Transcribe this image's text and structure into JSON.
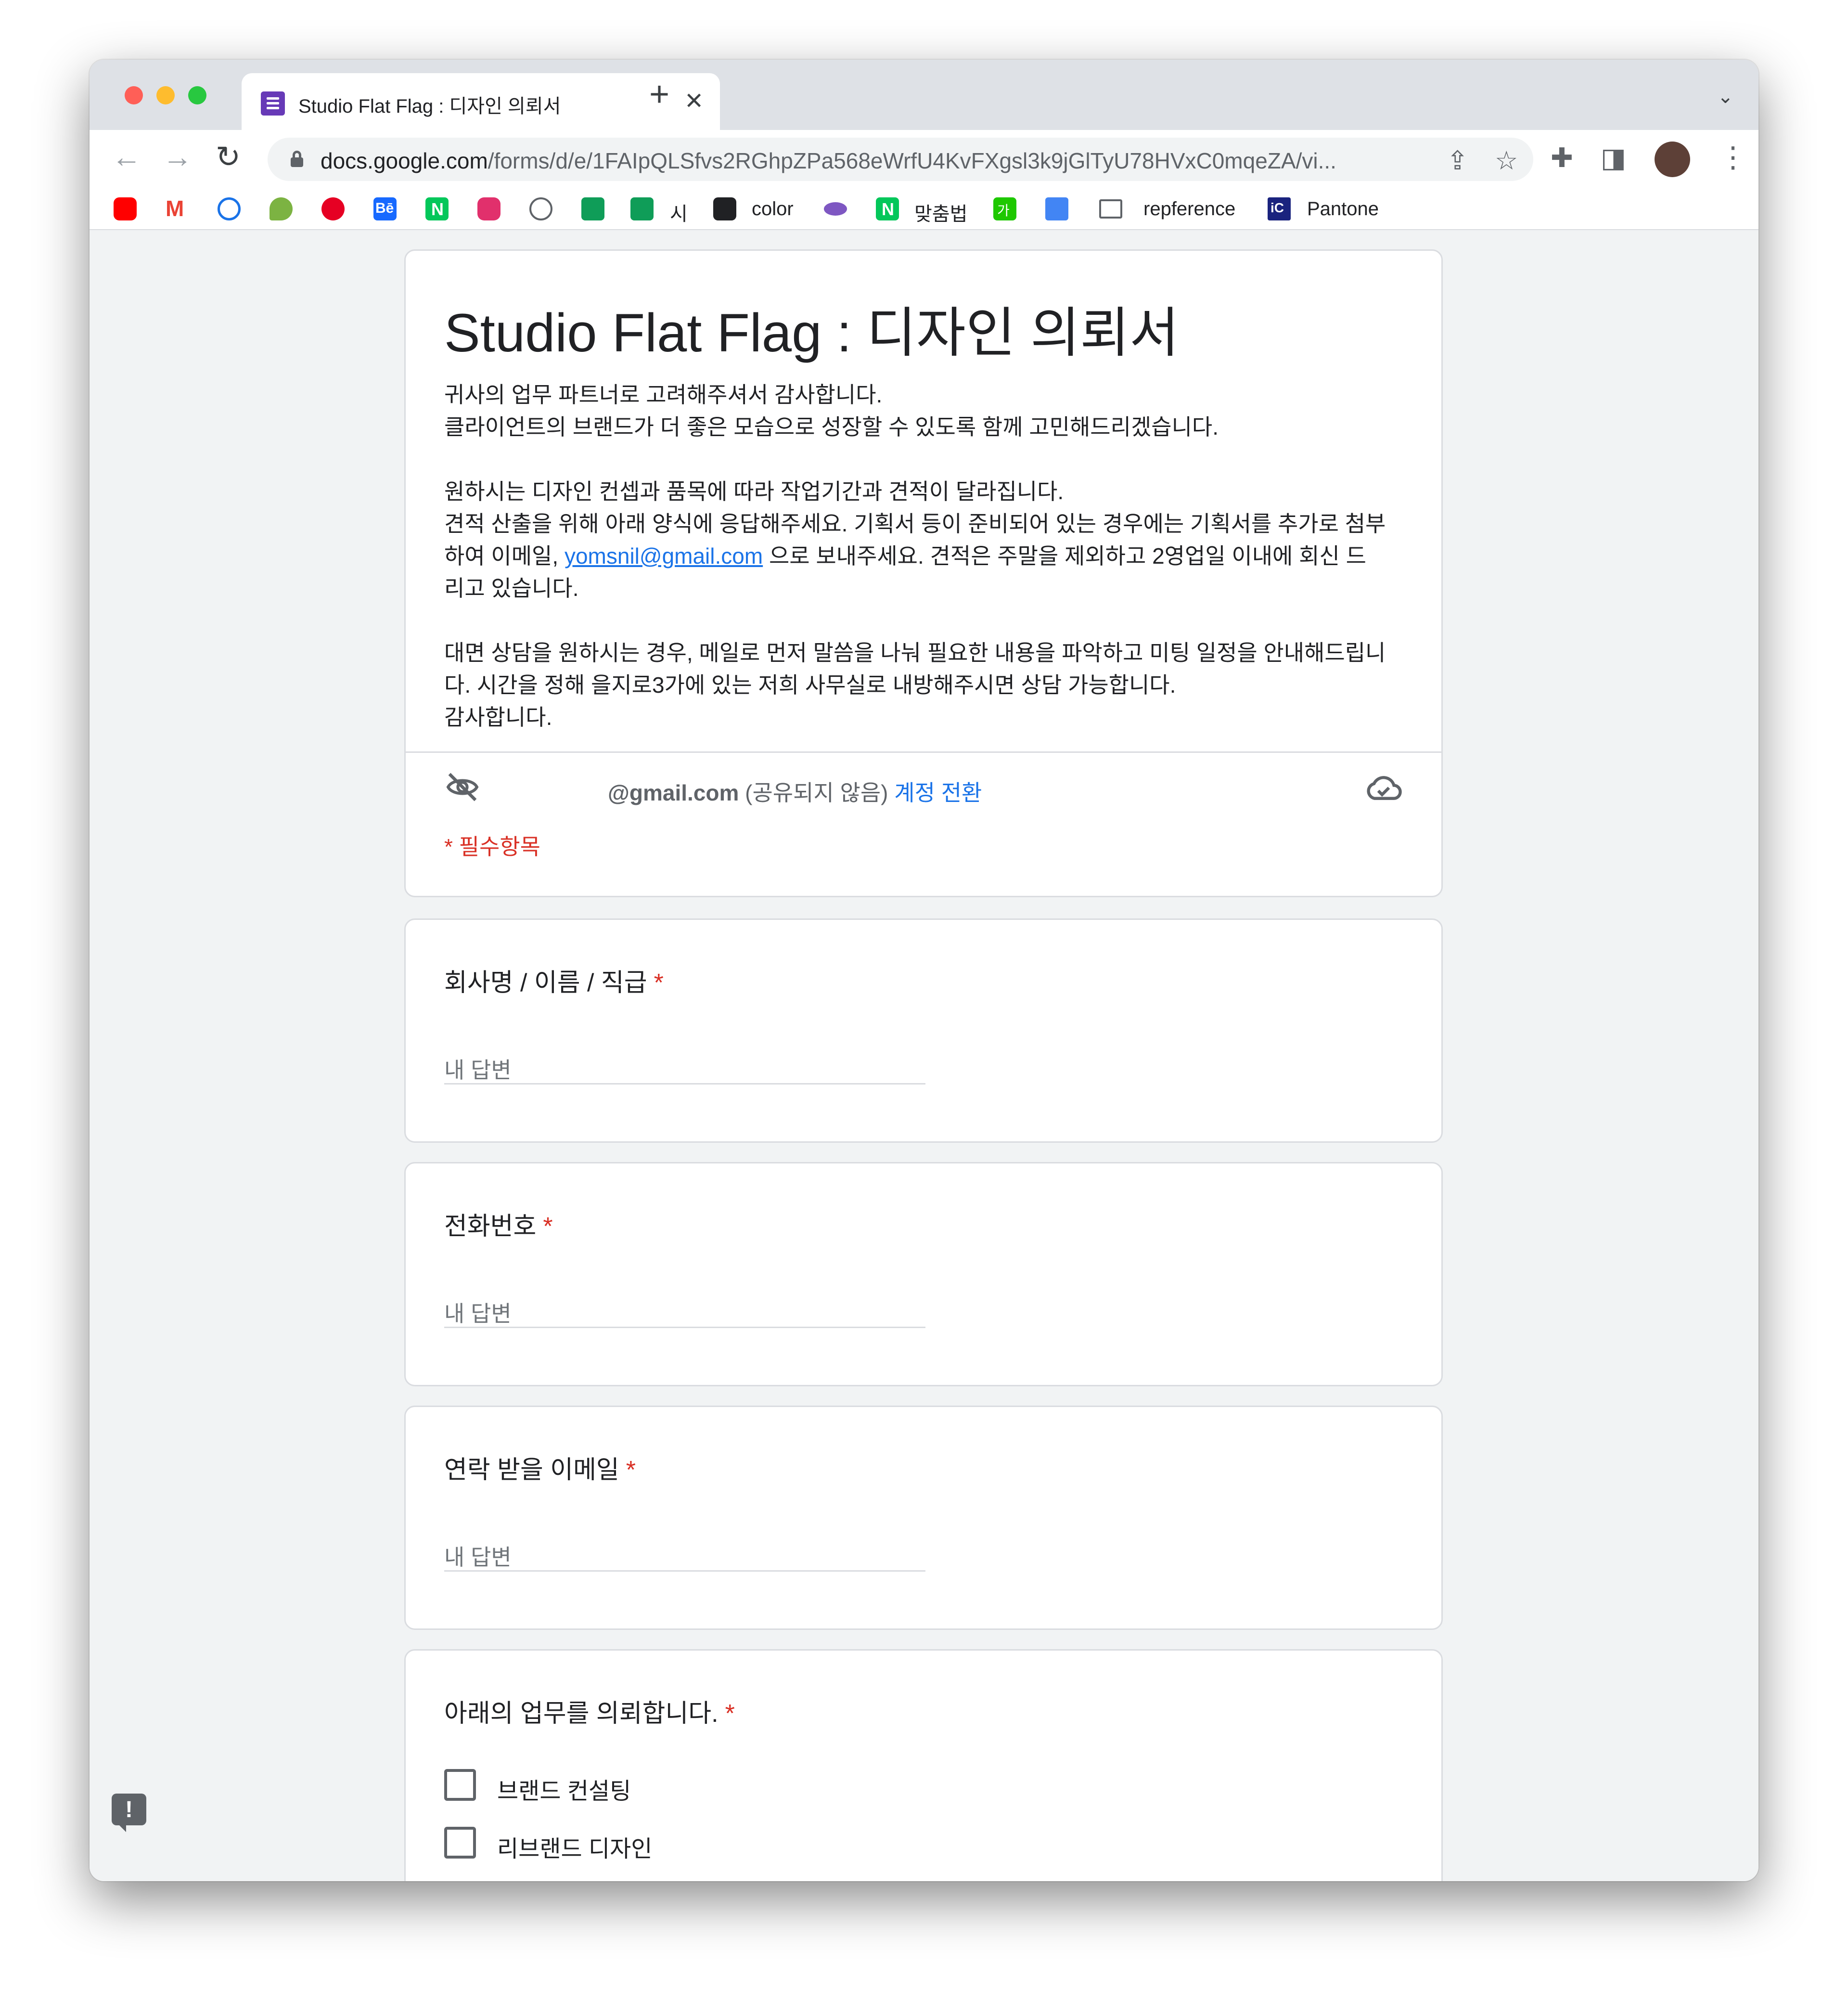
{
  "browser": {
    "tab_title": "Studio Flat Flag : 디자인 의뢰서",
    "tab_close": "✕",
    "new_tab": "+",
    "tab_menu": "⌄",
    "url_domain": "docs.google.com",
    "url_path": "/forms/d/e/1FAIpQLSfvs2RGhpZPa568eWrfU4KvFXgsl3k9jGlTyU78HVxC0mqeZA/vi...",
    "nav": {
      "back": "←",
      "forward": "→",
      "reload": "↻"
    },
    "icons": [
      "lock-icon",
      "share-icon",
      "star-icon",
      "extensions-icon",
      "side-panel-icon",
      "profile-avatar",
      "menu-icon"
    ],
    "share_glyph": "⇪",
    "star_glyph": "☆",
    "ext_glyph": "✚",
    "side_glyph": "◨",
    "kebab_glyph": "⋮"
  },
  "bookmarks": {
    "si": "시",
    "color": "color",
    "matchumbeop": "맞춤법",
    "ga": "가",
    "repference": "repference",
    "pantone": "Pantone",
    "n_glyph": "N",
    "be_glyph": "Bē",
    "ic_glyph": "iC",
    "colors": {
      "youtube": "#ff0000",
      "gmail": "#ea4335",
      "pinterest": "#e60023",
      "behance": "#1769ff",
      "naver": "#03c75a",
      "instagram": "#e1306c",
      "sheets": "#0f9d58"
    }
  },
  "form": {
    "title": "Studio Flat Flag : 디자인 의뢰서",
    "desc": {
      "p1_line1": "귀사의 업무 파트너로 고려해주셔서 감사합니다.",
      "p1_line2": "클라이언트의 브랜드가 더 좋은 모습으로 성장할 수 있도록 함께 고민해드리겠습니다.",
      "p2_line1": "원하시는 디자인 컨셉과 품목에 따라 작업기간과 견적이 달라집니다.",
      "p2_line2": "견적 산출을 위해 아래 양식에 응답해주세요. 기획서 등이 준비되어 있는 경우에는 기획서를 추가로 첨부",
      "p2_line3_pre": "하여 이메일, ",
      "email": "yomsnil@gmail.com",
      "p2_line3_post": " 으로 보내주세요. 견적은 주말을 제외하고 2영업일 이내에 회신 드",
      "p2_line4": "리고 있습니다.",
      "p3_line1": "대면 상담을 원하시는 경우, 메일로 먼저 말씀을 나눠 필요한 내용을 파악하고 미팅 일정을 안내해드립니",
      "p3_line2": "다. 시간을 정해 을지로3가에 있는 저희 사무실로 내방해주시면 상담 가능합니다.",
      "p3_line3": "감사합니다."
    },
    "account_email": "@gmail.com",
    "account_note": " (공유되지 않음) ",
    "account_switch": "계정 전환",
    "required_note": "* 필수항목",
    "questions": [
      {
        "title": "회사명 / 이름 / 직급",
        "placeholder": "내 답변"
      },
      {
        "title": "전화번호",
        "placeholder": "내 답변"
      },
      {
        "title": "연락 받을 이메일",
        "placeholder": "내 답변"
      }
    ],
    "q4": {
      "title": "아래의 업무를 의뢰합니다.",
      "options": [
        "브랜드 컨설팅",
        "리브랜드 디자인"
      ]
    },
    "required_star": "*"
  },
  "feedback_glyph": "!"
}
